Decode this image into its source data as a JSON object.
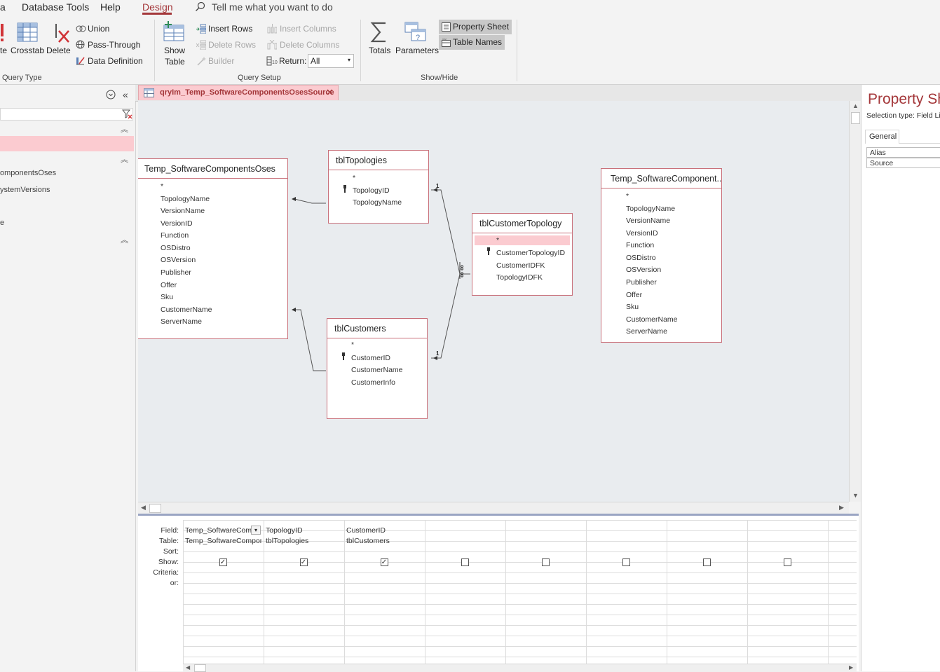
{
  "menubar": {
    "partial_left": "a",
    "database_tools": "Database Tools",
    "help": "Help",
    "design": "Design",
    "tell_me": "Tell me what you want to do"
  },
  "ribbon": {
    "query_type": {
      "make_table_partial": "te",
      "crosstab": "Crosstab",
      "delete": "Delete",
      "union": "Union",
      "pass_through": "Pass-Through",
      "data_definition": "Data Definition",
      "group_label": "Query Type"
    },
    "query_setup": {
      "show_table_line1": "Show",
      "show_table_line2": "Table",
      "insert_rows": "Insert Rows",
      "delete_rows": "Delete Rows",
      "builder": "Builder",
      "insert_columns": "Insert Columns",
      "delete_columns": "Delete Columns",
      "return_label": "Return:",
      "return_value": "All",
      "group_label": "Query Setup"
    },
    "show_hide": {
      "totals": "Totals",
      "parameters": "Parameters",
      "property_sheet": "Property Sheet",
      "table_names": "Table Names",
      "group_label": "Show/Hide"
    }
  },
  "nav": {
    "items": [
      "omponentsOses",
      "ystemVersions",
      "e"
    ]
  },
  "document_tab": {
    "title": "qryIm_Temp_SoftwareComponentsOsesSource"
  },
  "tables": {
    "temp_oses": {
      "title": "Temp_SoftwareComponentsOses",
      "fields": [
        "*",
        "TopologyName",
        "VersionName",
        "VersionID",
        "Function",
        "OSDistro",
        "OSVersion",
        "Publisher",
        "Offer",
        "Sku",
        "CustomerName",
        "ServerName"
      ]
    },
    "topologies": {
      "title": "tblTopologies",
      "fields": [
        "*",
        "TopologyID",
        "TopologyName"
      ]
    },
    "customer_topology": {
      "title": "tblCustomerTopology",
      "fields": [
        "*",
        "CustomerTopologyID",
        "CustomerIDFK",
        "TopologyIDFK"
      ]
    },
    "customers": {
      "title": "tblCustomers",
      "fields": [
        "*",
        "CustomerID",
        "CustomerName",
        "CustomerInfo"
      ]
    },
    "temp_oses_source": {
      "title": "Temp_SoftwareComponent...",
      "fields": [
        "*",
        "TopologyName",
        "VersionName",
        "VersionID",
        "Function",
        "OSDistro",
        "OSVersion",
        "Publisher",
        "Offer",
        "Sku",
        "CustomerName",
        "ServerName"
      ]
    }
  },
  "relationships": {
    "one_label": "1",
    "many_label": "∞"
  },
  "grid": {
    "row_labels": [
      "Field:",
      "Table:",
      "Sort:",
      "Show:",
      "Criteria:",
      "or:"
    ],
    "columns": [
      {
        "field": "Temp_SoftwareCom",
        "table": "Temp_SoftwareCompon",
        "show": true
      },
      {
        "field": "TopologyID",
        "table": "tblTopologies",
        "show": true
      },
      {
        "field": "CustomerID",
        "table": "tblCustomers",
        "show": true
      },
      {
        "field": "",
        "table": "",
        "show": false
      },
      {
        "field": "",
        "table": "",
        "show": false
      },
      {
        "field": "",
        "table": "",
        "show": false
      },
      {
        "field": "",
        "table": "",
        "show": false
      },
      {
        "field": "",
        "table": "",
        "show": false
      }
    ]
  },
  "property_sheet": {
    "title": "Property Sh",
    "selection_type": "Selection type:  Field Li",
    "tab": "General",
    "rows": [
      "Alias",
      "Source"
    ]
  },
  "colors": {
    "accent": "#a4373a",
    "selection": "#fbcbd0",
    "surface": "#e9ecef"
  }
}
